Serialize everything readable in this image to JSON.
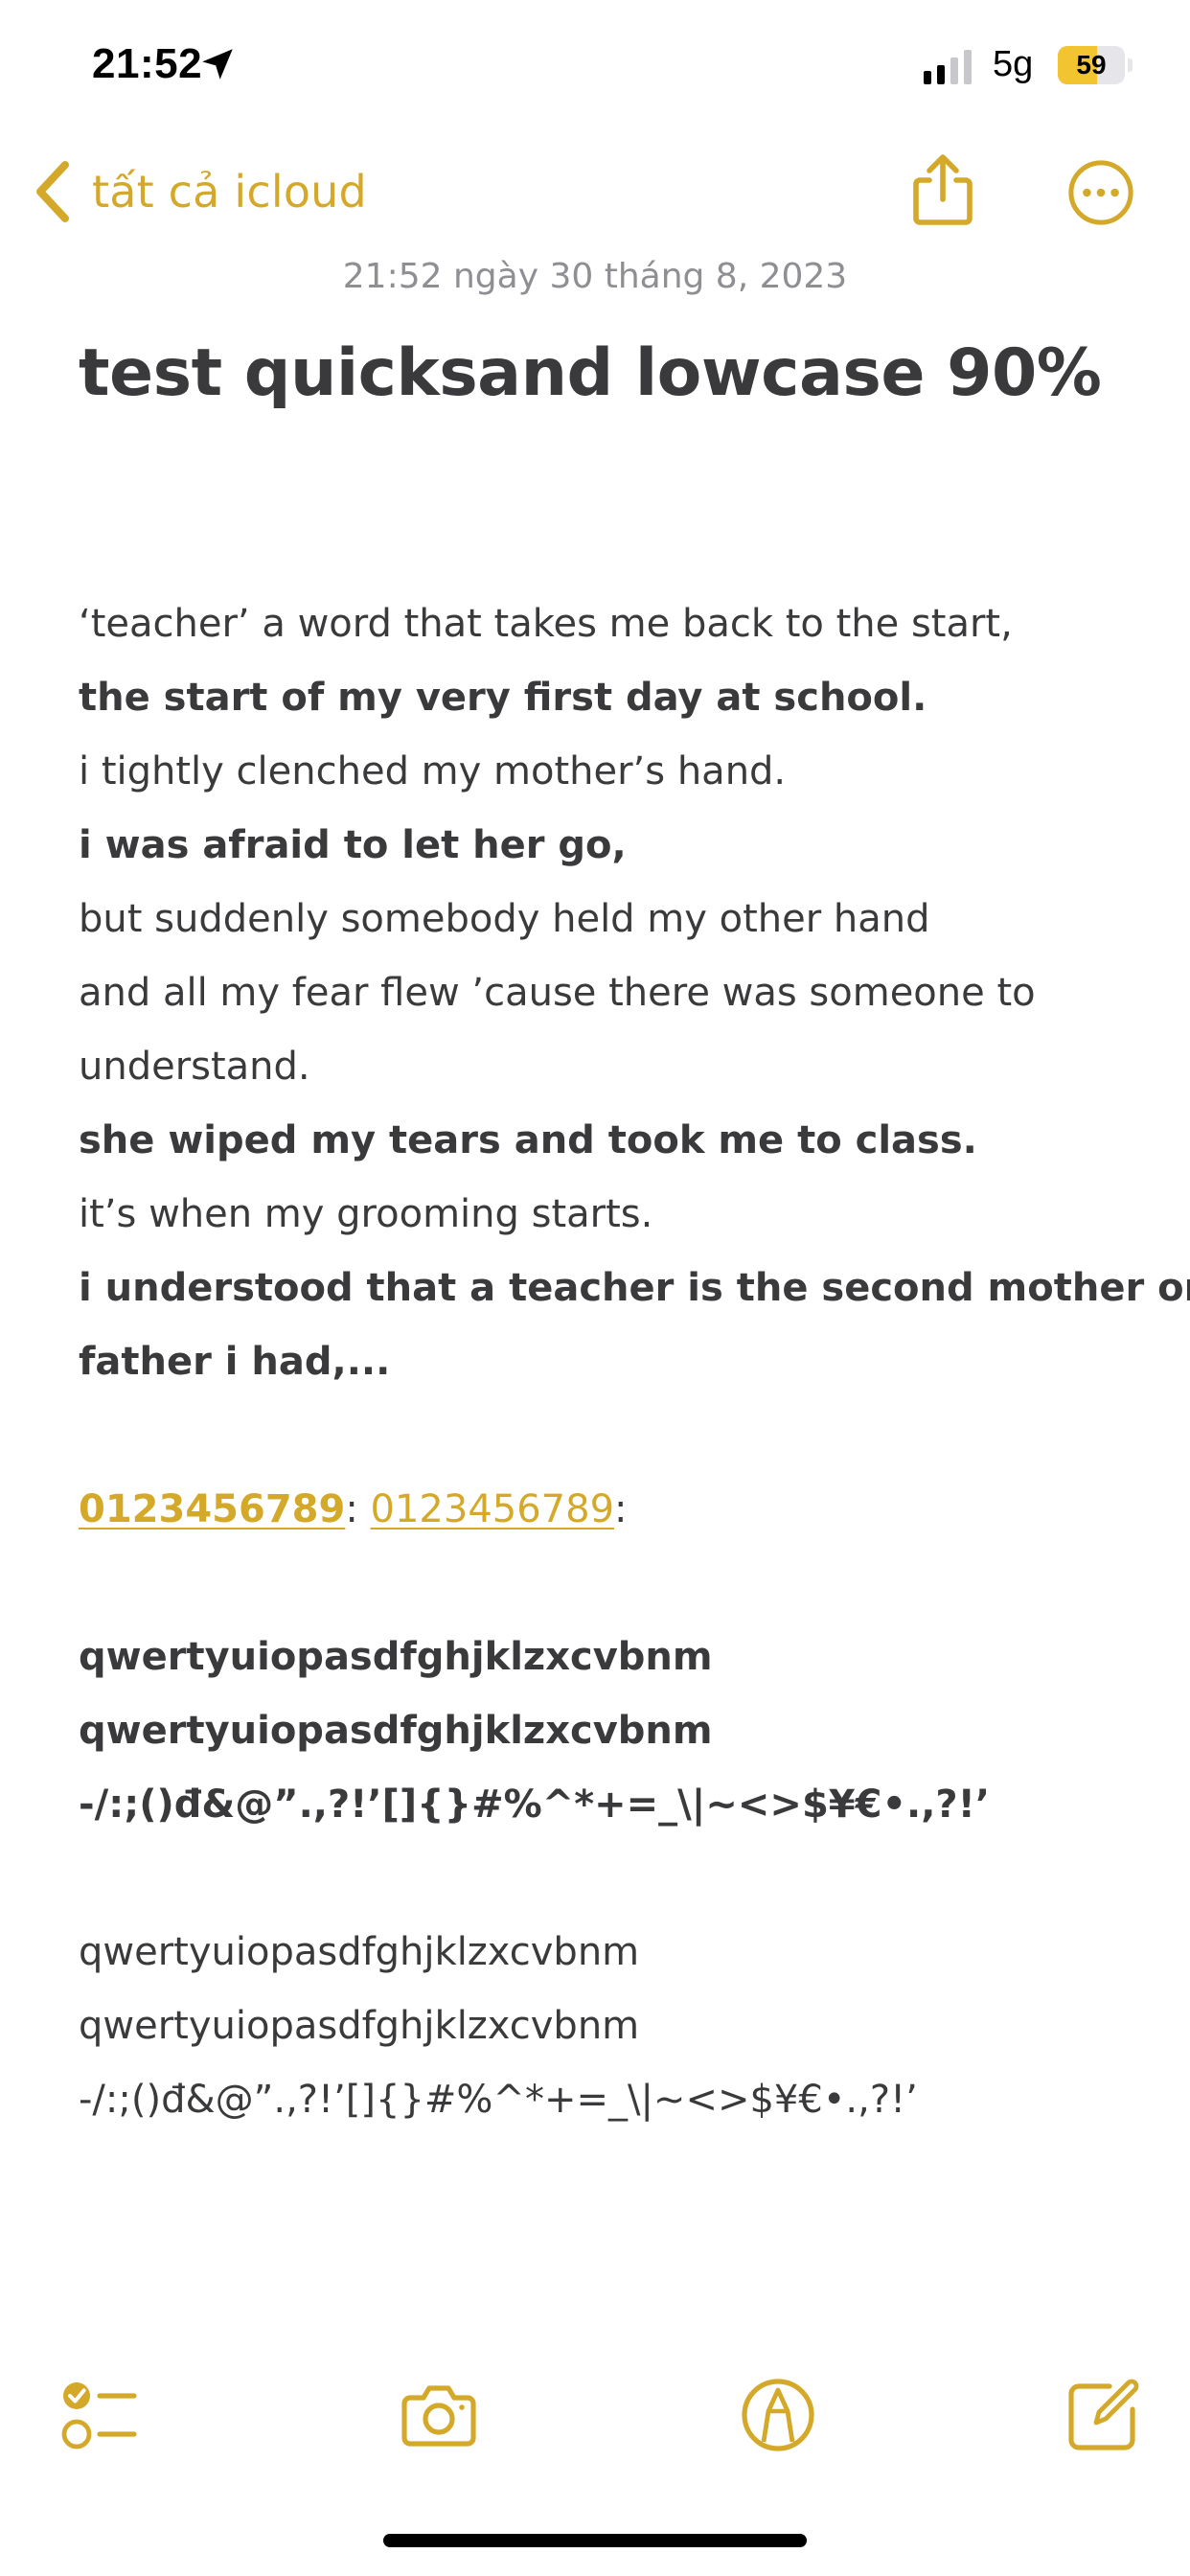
{
  "status_bar": {
    "time": "21:52",
    "network": "5g",
    "battery_level": "59",
    "battery_fraction": 0.59
  },
  "nav": {
    "back_label": "tất cả icloud"
  },
  "note": {
    "date": "21:52 ngày 30 tháng 8, 2023",
    "title": "test quicksand lowcase 90%",
    "lines": [
      "‘teacher’ a word that takes me back to the start,",
      "the start of my very first day at school.",
      "i tightly clenched my mother’s hand.",
      "i was afraid to let her go,",
      "but suddenly somebody held my other hand",
      "and all my fear flew ’cause there was someone to",
      "understand.",
      "she wiped my tears and took me to class.",
      "it’s when my grooming starts.",
      "i understood that a teacher is the second mother or",
      "father i had,..."
    ],
    "phone_1": "0123456789",
    "phone_sep": ": ",
    "phone_2": "0123456789",
    "phone_end": ":",
    "bold_lines": [
      "qwertyuiopasdfghjklzxcvbnm",
      "qwertyuiopasdfghjklzxcvbnm",
      "-/:;()đ&@”.,?!’[]{}#%^*+=_\\|~<>$¥€•.,?!’"
    ],
    "regular_lines": [
      "qwertyuiopasdfghjklzxcvbnm",
      "qwertyuiopasdfghjklzxcvbnm",
      "-/:;()đ&@”.,?!’[]{}#%^*+=_\\|~<>$¥€•.,?!’"
    ]
  },
  "colors": {
    "accent": "#d4a92a",
    "text": "#3a3a3c",
    "date": "#8e8e93",
    "battery": "#f2c530"
  },
  "icons": {
    "location": "location-arrow-icon",
    "signal": "cellular-signal-icon",
    "back": "chevron-left-icon",
    "share": "share-icon",
    "more": "ellipsis-circle-icon",
    "checklist": "checklist-icon",
    "camera": "camera-icon",
    "markup": "markup-pen-icon",
    "compose": "compose-icon"
  }
}
